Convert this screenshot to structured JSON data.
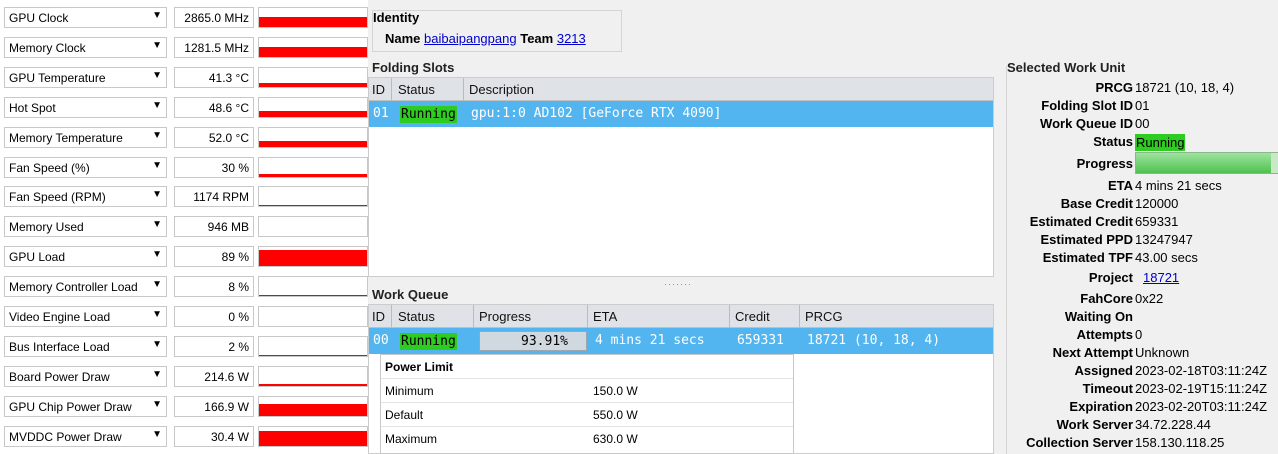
{
  "sensors": [
    {
      "name": "GPU Clock",
      "value": "2865.0 MHz",
      "fill": 0.55
    },
    {
      "name": "Memory Clock",
      "value": "1281.5 MHz",
      "fill": 0.5
    },
    {
      "name": "GPU Temperature",
      "value": "41.3 °C",
      "fill": 0.22
    },
    {
      "name": "Hot Spot",
      "value": "48.6 °C",
      "fill": 0.28
    },
    {
      "name": "Memory Temperature",
      "value": "52.0 °C",
      "fill": 0.3
    },
    {
      "name": "Fan Speed (%)",
      "value": "30 %",
      "fill": 0.12
    },
    {
      "name": "Fan Speed (RPM)",
      "value": "1174 RPM",
      "fill": 0.1
    },
    {
      "name": "Memory Used",
      "value": "946 MB",
      "fill": 0.03
    },
    {
      "name": "GPU Load",
      "value": "89 %",
      "fill": 0.85
    },
    {
      "name": "Memory Controller Load",
      "value": "8 %",
      "fill": 0.08
    },
    {
      "name": "Video Engine Load",
      "value": "0 %",
      "fill": 0.0
    },
    {
      "name": "Bus Interface Load",
      "value": "2 %",
      "fill": 0.03
    },
    {
      "name": "Board Power Draw",
      "value": "214.6 W",
      "fill": 0.12
    },
    {
      "name": "GPU Chip Power Draw",
      "value": "166.9 W",
      "fill": 0.6
    },
    {
      "name": "MVDDC Power Draw",
      "value": "30.4 W",
      "fill": 0.75
    }
  ],
  "identity": {
    "title": "Identity",
    "name_label": "Name",
    "name": "baibaipangpang",
    "team_label": "Team",
    "team": "3213"
  },
  "folding_slots": {
    "title": "Folding Slots",
    "headers": [
      "ID",
      "Status",
      "Description"
    ],
    "row": {
      "id": "01",
      "status": "Running",
      "description": "gpu:1:0 AD102 [GeForce RTX 4090]"
    }
  },
  "work_queue": {
    "title": "Work Queue",
    "headers": [
      "ID",
      "Status",
      "Progress",
      "ETA",
      "Credit",
      "PRCG"
    ],
    "row": {
      "id": "00",
      "status": "Running",
      "progress": "93.91%",
      "eta": "4 mins 21 secs",
      "credit": "659331",
      "prcg": "18721 (10, 18, 4)"
    }
  },
  "power_limit": {
    "title": "Power Limit",
    "rows": [
      {
        "label": "Minimum",
        "value": "150.0 W"
      },
      {
        "label": "Default",
        "value": "550.0 W"
      },
      {
        "label": "Maximum",
        "value": "630.0 W"
      }
    ]
  },
  "selected_wu": {
    "title": "Selected Work Unit",
    "prcg": {
      "k": "PRCG",
      "v": "18721 (10, 18, 4)"
    },
    "folding_slot_id": {
      "k": "Folding Slot ID",
      "v": "01"
    },
    "work_queue_id": {
      "k": "Work Queue ID",
      "v": "00"
    },
    "status": {
      "k": "Status",
      "v": "Running"
    },
    "progress": {
      "k": "Progress",
      "value": 0.9391
    },
    "eta": {
      "k": "ETA",
      "v": "4 mins 21 secs"
    },
    "base_credit": {
      "k": "Base Credit",
      "v": "120000"
    },
    "estimated_credit": {
      "k": "Estimated Credit",
      "v": "659331"
    },
    "estimated_ppd": {
      "k": "Estimated PPD",
      "v": "13247947"
    },
    "estimated_tpf": {
      "k": "Estimated TPF",
      "v": "43.00 secs"
    },
    "project": {
      "k": "Project",
      "v": "18721"
    },
    "fahcore": {
      "k": "FahCore",
      "v": "0x22"
    },
    "waiting_on": {
      "k": "Waiting On",
      "v": ""
    },
    "attempts": {
      "k": "Attempts",
      "v": "0"
    },
    "next_attempt": {
      "k": "Next Attempt",
      "v": "Unknown"
    },
    "assigned": {
      "k": "Assigned",
      "v": "2023-02-18T03:11:24Z"
    },
    "timeout": {
      "k": "Timeout",
      "v": "2023-02-19T15:11:24Z"
    },
    "expiration": {
      "k": "Expiration",
      "v": "2023-02-20T03:11:24Z"
    },
    "work_server": {
      "k": "Work Server",
      "v": "34.72.228.44"
    },
    "collection_server": {
      "k": "Collection Server",
      "v": "158.130.118.25"
    }
  },
  "colors": {
    "graph": "#ff0000",
    "running": "#2ecc20",
    "selection": "#52b5ef"
  }
}
